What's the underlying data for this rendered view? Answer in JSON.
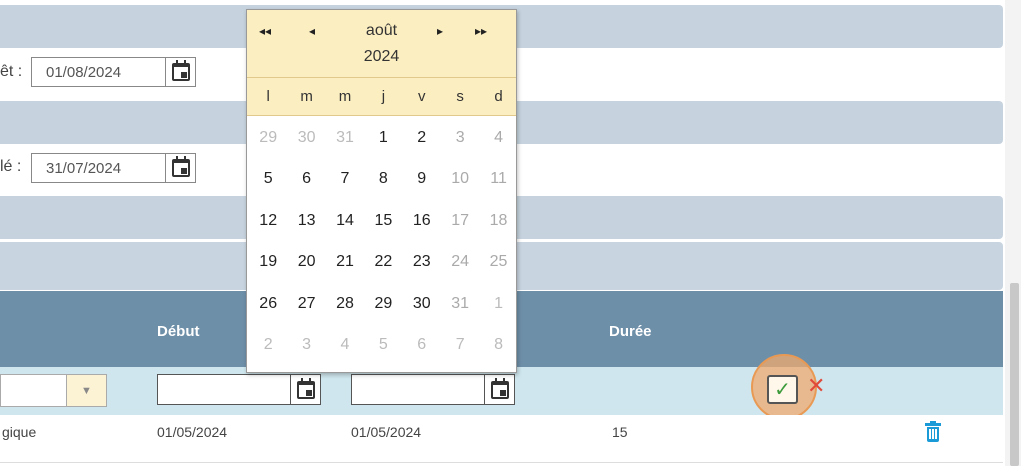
{
  "form": {
    "row1_label": "êt :",
    "row1_value": "01/08/2024",
    "row2_label": "lé :",
    "row2_value": "31/07/2024"
  },
  "table": {
    "headers": {
      "debut": "Début",
      "duree": "Durée"
    },
    "filter": {
      "select_arrow": "▼",
      "ok_label": "✓",
      "cancel_label": "✕"
    },
    "row": {
      "col1": "gique",
      "debut": "01/05/2024",
      "fin": "01/05/2024",
      "duree": "15"
    }
  },
  "datepicker": {
    "nav": {
      "prev_year": "◂◂",
      "prev_month": "◂",
      "next_month": "▸",
      "next_year": "▸▸"
    },
    "month": "août",
    "year": "2024",
    "weekdays": [
      "l",
      "m",
      "m",
      "j",
      "v",
      "s",
      "d"
    ],
    "weeks": [
      [
        {
          "d": "29",
          "o": true
        },
        {
          "d": "30",
          "o": true
        },
        {
          "d": "31",
          "o": true
        },
        {
          "d": "1"
        },
        {
          "d": "2"
        },
        {
          "d": "3",
          "w": true
        },
        {
          "d": "4",
          "w": true
        }
      ],
      [
        {
          "d": "5"
        },
        {
          "d": "6"
        },
        {
          "d": "7"
        },
        {
          "d": "8"
        },
        {
          "d": "9"
        },
        {
          "d": "10",
          "w": true
        },
        {
          "d": "11",
          "w": true
        }
      ],
      [
        {
          "d": "12"
        },
        {
          "d": "13"
        },
        {
          "d": "14"
        },
        {
          "d": "15"
        },
        {
          "d": "16"
        },
        {
          "d": "17",
          "w": true
        },
        {
          "d": "18",
          "w": true
        }
      ],
      [
        {
          "d": "19"
        },
        {
          "d": "20"
        },
        {
          "d": "21"
        },
        {
          "d": "22"
        },
        {
          "d": "23"
        },
        {
          "d": "24",
          "w": true
        },
        {
          "d": "25",
          "w": true
        }
      ],
      [
        {
          "d": "26"
        },
        {
          "d": "27"
        },
        {
          "d": "28"
        },
        {
          "d": "29"
        },
        {
          "d": "30"
        },
        {
          "d": "31",
          "w": true
        },
        {
          "d": "1",
          "o": true
        }
      ],
      [
        {
          "d": "2",
          "o": true
        },
        {
          "d": "3",
          "o": true
        },
        {
          "d": "4",
          "o": true
        },
        {
          "d": "5",
          "o": true
        },
        {
          "d": "6",
          "o": true
        },
        {
          "d": "7",
          "o": true
        },
        {
          "d": "8",
          "o": true
        }
      ]
    ]
  },
  "colors": {
    "band": "#c6d3de",
    "table_header": "#6e8fa8",
    "filter_row": "#cfe6ee",
    "picker_header": "#fbeec1",
    "accent_ok": "#3b9a3b",
    "accent_cancel": "#e04a3a",
    "trash": "#1a9ad6"
  }
}
